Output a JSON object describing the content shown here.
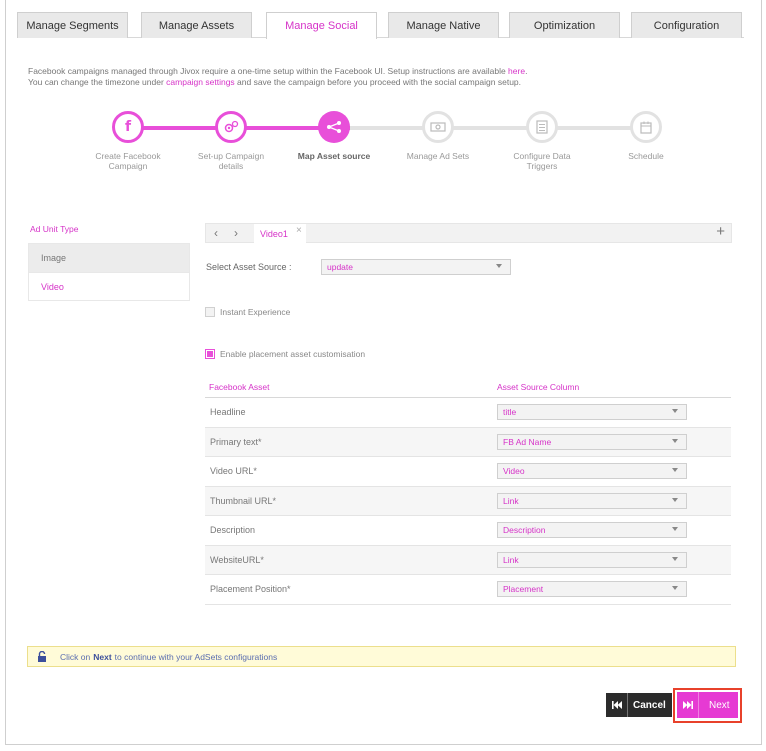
{
  "tabs": [
    {
      "label": "Manage Segments"
    },
    {
      "label": "Manage Assets"
    },
    {
      "label": "Manage Social"
    },
    {
      "label": "Manage Native"
    },
    {
      "label": "Optimization"
    },
    {
      "label": "Configuration"
    }
  ],
  "active_tab": "Manage Social",
  "intro": {
    "line1": "Facebook campaigns managed through Jivox require a one-time setup within the Facebook UI. Setup instructions are available ",
    "line1_link": "here",
    "line1_end": ".",
    "line2_start": "You can change the timezone under ",
    "line2_link": "campaign settings",
    "line2_end": " and save the campaign before you proceed with the social campaign setup."
  },
  "steps": [
    {
      "label": "Create Facebook Campaign",
      "state": "done",
      "icon": "facebook-icon"
    },
    {
      "label": "Set-up Campaign details",
      "state": "done",
      "icon": "gears-icon"
    },
    {
      "label": "Map Asset source",
      "state": "current",
      "icon": "share-nodes-icon"
    },
    {
      "label": "Manage Ad Sets",
      "state": "todo",
      "icon": "money-icon"
    },
    {
      "label": "Configure Data Triggers",
      "state": "todo",
      "icon": "checklist-icon"
    },
    {
      "label": "Schedule",
      "state": "todo",
      "icon": "calendar-icon"
    }
  ],
  "ad_unit": {
    "title": "Ad Unit Type",
    "items": [
      "Image",
      "Video"
    ],
    "selected": "Video"
  },
  "subtabs": {
    "prev_icon": "chevron-left-icon",
    "next_icon": "chevron-right-icon",
    "tab_label": "Video1",
    "close_symbol": "×",
    "add_symbol": "+"
  },
  "asset_source": {
    "label": "Select Asset Source :",
    "value": "update"
  },
  "instant_experience": {
    "label": "Instant Experience",
    "checked": false
  },
  "placement_customisation": {
    "label": "Enable placement asset customisation",
    "checked": true
  },
  "mapping_table": {
    "col_asset": "Facebook Asset",
    "col_source": "Asset Source Column",
    "rows": [
      {
        "asset": "Headline",
        "source": "title"
      },
      {
        "asset": "Primary text*",
        "source": "FB Ad Name"
      },
      {
        "asset": "Video URL*",
        "source": "Video"
      },
      {
        "asset": "Thumbnail URL*",
        "source": "Link"
      },
      {
        "asset": "Description",
        "source": "Description"
      },
      {
        "asset": "WebsiteURL*",
        "source": "Link"
      },
      {
        "asset": "Placement Position*",
        "source": "Placement"
      }
    ]
  },
  "info": {
    "pre": "Click on",
    "bold": "Next",
    "post": "to continue with your AdSets configurations"
  },
  "buttons": {
    "cancel": "Cancel",
    "next": "Next"
  },
  "colors": {
    "accent": "#e84fd9",
    "highlight_outline": "#e8412b"
  }
}
